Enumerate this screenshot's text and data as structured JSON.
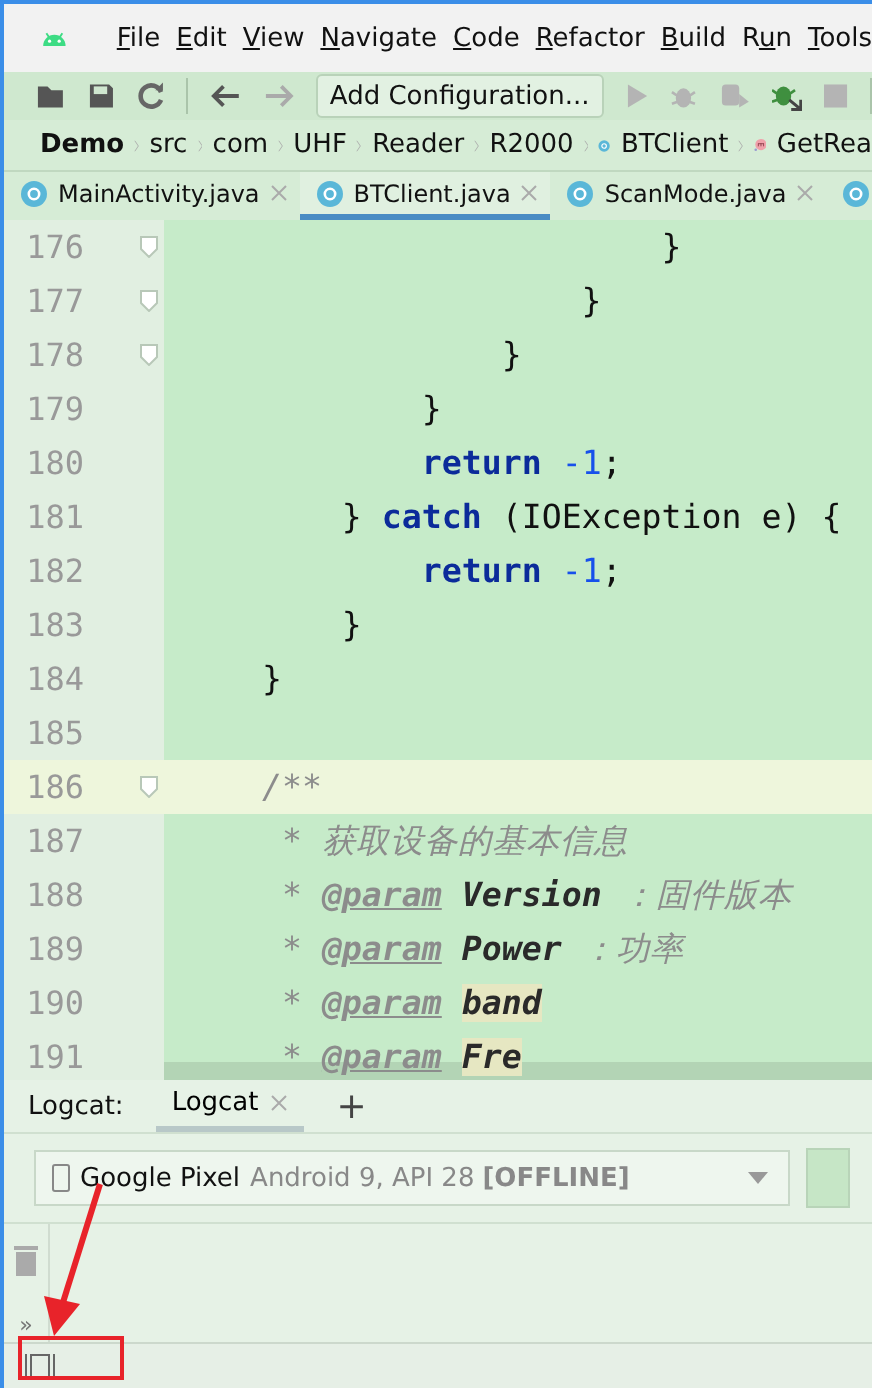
{
  "menu": [
    {
      "key": "F",
      "after": "ile"
    },
    {
      "key": "E",
      "after": "dit"
    },
    {
      "key": "V",
      "after": "iew"
    },
    {
      "key": "N",
      "after": "avigate"
    },
    {
      "key": "C",
      "after": "ode"
    },
    {
      "key": "R",
      "after": "efactor"
    },
    {
      "key": "B",
      "after": "uild"
    },
    {
      "before": "R",
      "key": "u",
      "after": "n"
    },
    {
      "key": "T",
      "after": "ools"
    }
  ],
  "toolbar": {
    "configuration": "Add Configuration...",
    "run_disabled": true
  },
  "breadcrumb": [
    {
      "label": "Demo",
      "kind": "project"
    },
    {
      "label": "src",
      "kind": "folder"
    },
    {
      "label": "com",
      "kind": "folder"
    },
    {
      "label": "UHF",
      "kind": "folder"
    },
    {
      "label": "Reader",
      "kind": "folder"
    },
    {
      "label": "R2000",
      "kind": "folder"
    },
    {
      "label": "BTClient",
      "kind": "class"
    },
    {
      "label": "GetRea",
      "kind": "method"
    }
  ],
  "tabs": [
    {
      "label": "MainActivity.java",
      "selected": false
    },
    {
      "label": "BTClient.java",
      "selected": true
    },
    {
      "label": "ScanMode.java",
      "selected": false
    },
    {
      "selected": false
    }
  ],
  "code": [
    {
      "number": "176",
      "fold": true,
      "current": false,
      "tokens": [
        {
          "kind": "plain",
          "text": "                        }"
        }
      ]
    },
    {
      "number": "177",
      "fold": true,
      "current": false,
      "tokens": [
        {
          "kind": "plain",
          "text": "                    }"
        }
      ]
    },
    {
      "number": "178",
      "fold": true,
      "current": false,
      "tokens": [
        {
          "kind": "plain",
          "text": "                }"
        }
      ]
    },
    {
      "number": "179",
      "fold": false,
      "current": false,
      "tokens": [
        {
          "kind": "plain",
          "text": "            }"
        }
      ]
    },
    {
      "number": "180",
      "fold": false,
      "current": false,
      "tokens": [
        {
          "kind": "keyword",
          "text": "            return "
        },
        {
          "kind": "number",
          "text": "-1"
        },
        {
          "kind": "plain",
          "text": ";"
        }
      ]
    },
    {
      "number": "181",
      "fold": false,
      "current": false,
      "tokens": [
        {
          "kind": "plain",
          "text": "        } "
        },
        {
          "kind": "keyword",
          "text": "catch"
        },
        {
          "kind": "plain",
          "text": " (IOException e) {"
        }
      ]
    },
    {
      "number": "182",
      "fold": false,
      "current": false,
      "tokens": [
        {
          "kind": "keyword",
          "text": "            return "
        },
        {
          "kind": "number",
          "text": "-1"
        },
        {
          "kind": "plain",
          "text": ";"
        }
      ]
    },
    {
      "number": "183",
      "fold": false,
      "current": false,
      "tokens": [
        {
          "kind": "plain",
          "text": "        }"
        }
      ]
    },
    {
      "number": "184",
      "fold": false,
      "current": false,
      "tokens": [
        {
          "kind": "plain",
          "text": "    }"
        }
      ]
    },
    {
      "number": "185",
      "fold": false,
      "current": false
    },
    {
      "number": "186",
      "fold": true,
      "current": true,
      "tokens": [
        {
          "kind": "comment",
          "text": "    /**"
        }
      ]
    },
    {
      "number": "187",
      "fold": false,
      "current": false,
      "tokens": [
        {
          "kind": "comment",
          "text": "     * 获取设备的基本信息"
        }
      ]
    },
    {
      "number": "188",
      "fold": false,
      "current": false,
      "tokens": [
        {
          "kind": "comment",
          "text": "     * "
        },
        {
          "kind": "doctag",
          "text": "@param"
        },
        {
          "kind": "param",
          "text": " Version"
        },
        {
          "kind": "comment",
          "text": " ：固件版本"
        }
      ]
    },
    {
      "number": "189",
      "fold": false,
      "current": false,
      "tokens": [
        {
          "kind": "comment",
          "text": "     * "
        },
        {
          "kind": "doctag",
          "text": "@param"
        },
        {
          "kind": "param",
          "text": " Power"
        },
        {
          "kind": "comment",
          "text": " ：功率"
        }
      ]
    },
    {
      "number": "190",
      "fold": false,
      "current": false,
      "tokens": [
        {
          "kind": "comment",
          "text": "     * "
        },
        {
          "kind": "doctag",
          "text": "@param"
        },
        {
          "kind": "marked",
          "text": " band"
        }
      ]
    },
    {
      "number": "191",
      "fold": false,
      "current": false,
      "tokens": [
        {
          "kind": "comment",
          "text": "     * "
        },
        {
          "kind": "doctag",
          "text": "@param"
        },
        {
          "kind": "marked",
          "text": " Fre"
        }
      ]
    }
  ],
  "logcat": {
    "label": "Logcat:",
    "tabs": [
      {
        "label": "Logcat",
        "selected": true
      }
    ],
    "add": "+",
    "device": {
      "name": "Google Pixel",
      "detail": "Android 9, API 28",
      "state": "[OFFLINE]"
    },
    "toolbar": [
      "»"
    ]
  }
}
